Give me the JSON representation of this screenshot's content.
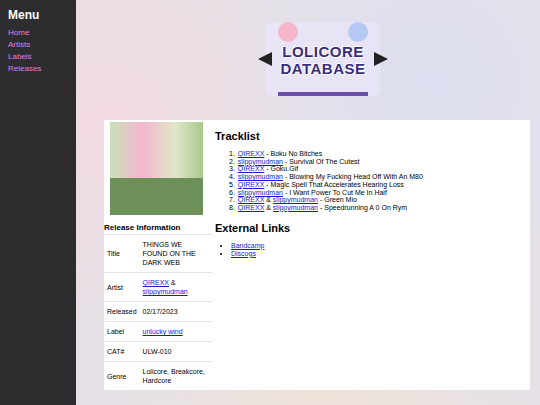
{
  "menu": {
    "title": "Menu",
    "items": [
      {
        "label": "Home"
      },
      {
        "label": "Artists"
      },
      {
        "label": "Labels"
      },
      {
        "label": "Releases"
      }
    ]
  },
  "logo": {
    "text": "LOLICORE DATABASE"
  },
  "release": {
    "info_title": "Release Information",
    "fields": [
      {
        "label": "Title",
        "parts": [
          {
            "text": "THINGS WE FOUND ON THE DARK WEB",
            "link": false
          }
        ]
      },
      {
        "label": "Artist",
        "parts": [
          {
            "text": "QIREXX",
            "link": true
          },
          {
            "text": " & ",
            "link": false
          },
          {
            "text": "slippymudman",
            "link": true
          }
        ]
      },
      {
        "label": "Released",
        "parts": [
          {
            "text": "02/17/2023",
            "link": false
          }
        ]
      },
      {
        "label": "Label",
        "parts": [
          {
            "text": "unlucky wind",
            "link": true
          }
        ]
      },
      {
        "label": "CAT#",
        "parts": [
          {
            "text": "ULW-010",
            "link": false
          }
        ]
      },
      {
        "label": "Genre",
        "parts": [
          {
            "text": "Lolicore, Breakcore, Hardcore",
            "link": false
          }
        ]
      }
    ]
  },
  "tracklist": {
    "title": "Tracklist",
    "tracks": [
      {
        "number": "1.",
        "parts": [
          {
            "text": "QIREXX",
            "link": true
          },
          {
            "text": " - Boku No Bitches",
            "link": false
          }
        ]
      },
      {
        "number": "2.",
        "parts": [
          {
            "text": "slippymudman",
            "link": true
          },
          {
            "text": " - Survival Of The Cutest",
            "link": false
          }
        ]
      },
      {
        "number": "3.",
        "parts": [
          {
            "text": "QIREXX",
            "link": true
          },
          {
            "text": " - Goku.Gif",
            "link": false
          }
        ]
      },
      {
        "number": "4.",
        "parts": [
          {
            "text": "slippymudman",
            "link": true
          },
          {
            "text": " - Blowing My Fucking Head Off With An M80",
            "link": false
          }
        ]
      },
      {
        "number": "5.",
        "parts": [
          {
            "text": "QIREXX",
            "link": true
          },
          {
            "text": " - Magic Spell That Accelerates Hearing Loss",
            "link": false
          }
        ]
      },
      {
        "number": "6.",
        "parts": [
          {
            "text": "slippymudman",
            "link": true
          },
          {
            "text": " - I Want Power To Cut Me In Half",
            "link": false
          }
        ]
      },
      {
        "number": "7.",
        "parts": [
          {
            "text": "QIREXX",
            "link": true
          },
          {
            "text": " & ",
            "link": false
          },
          {
            "text": "slippymudman",
            "link": true
          },
          {
            "text": " - Green Mio",
            "link": false
          }
        ]
      },
      {
        "number": "8.",
        "parts": [
          {
            "text": "QIREXX",
            "link": true
          },
          {
            "text": " & ",
            "link": false
          },
          {
            "text": "slippymudman",
            "link": true
          },
          {
            "text": " - Speedrunning A 0 On Rym",
            "link": false
          }
        ]
      }
    ]
  },
  "external_links": {
    "title": "External Links",
    "items": [
      {
        "label": "Bandcamp"
      },
      {
        "label": "Discogs"
      }
    ]
  }
}
